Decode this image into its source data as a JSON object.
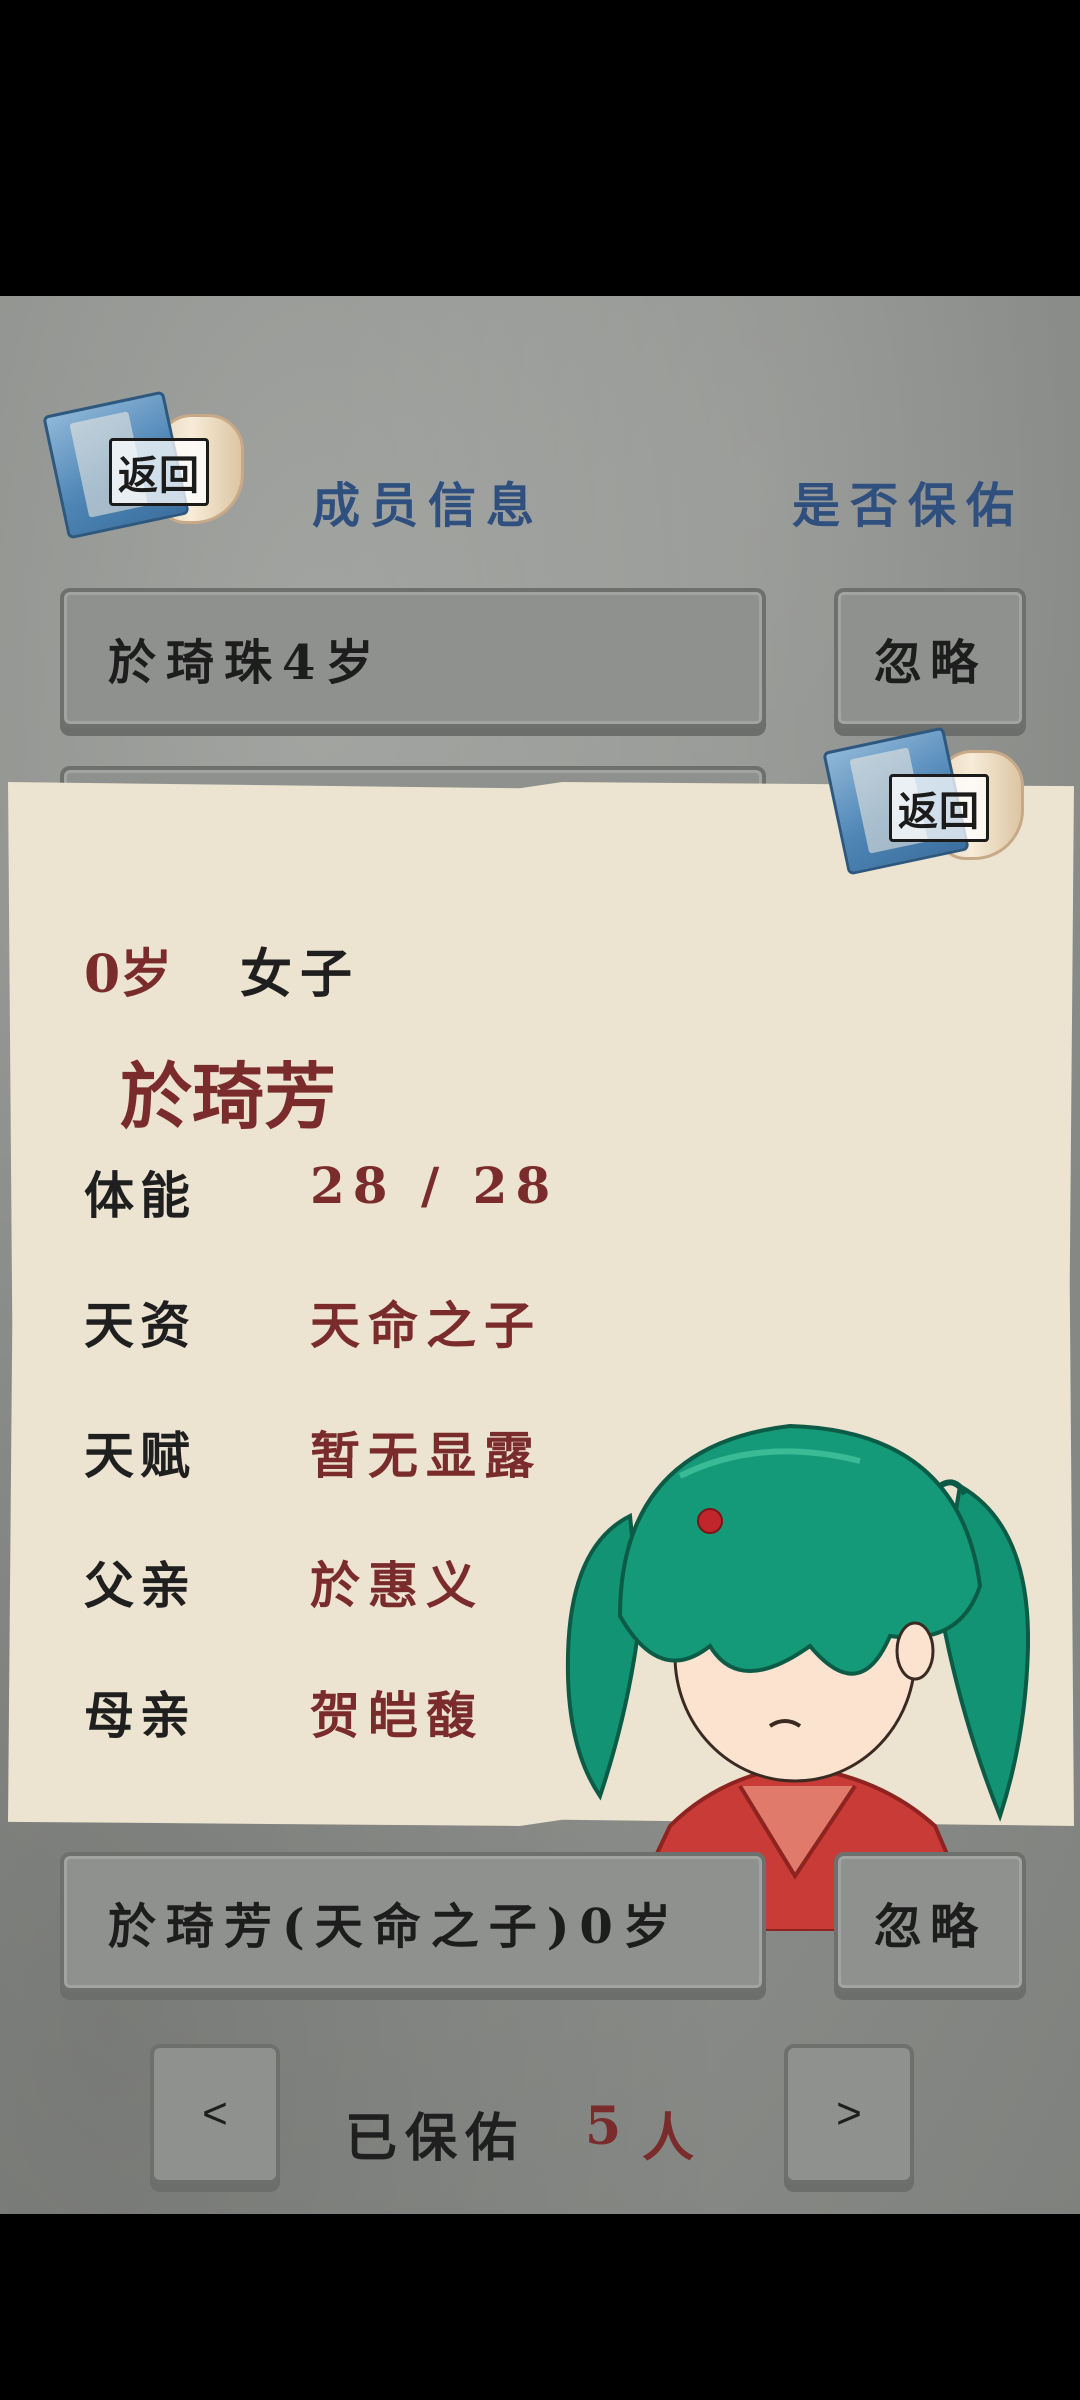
{
  "header": {
    "back_label": "返回",
    "members_title": "成员信息",
    "protect_title": "是否保佑"
  },
  "rows": [
    {
      "name": "於琦珠4岁",
      "action": "忽略"
    },
    {
      "name": "於琦芳(天命之子)0岁",
      "action": "忽略"
    }
  ],
  "card": {
    "back_label": "返回",
    "age": "0岁",
    "gender": "女子",
    "name": "於琦芳",
    "stats": [
      {
        "label": "体能",
        "value": "28 / 28"
      },
      {
        "label": "天资",
        "value": "天命之子"
      },
      {
        "label": "天赋",
        "value": "暂无显露"
      },
      {
        "label": "父亲",
        "value": "於惠义"
      },
      {
        "label": "母亲",
        "value": "贺皑馥"
      }
    ]
  },
  "footer": {
    "prev": "<",
    "next": ">",
    "blessed_label": "已保佑",
    "blessed_count": "5",
    "blessed_unit": "人"
  },
  "colors": {
    "accent_red": "#7a2b2b",
    "title_blue": "#2f4f7f",
    "hair_green": "#129474",
    "robe_red": "#c93b36"
  }
}
